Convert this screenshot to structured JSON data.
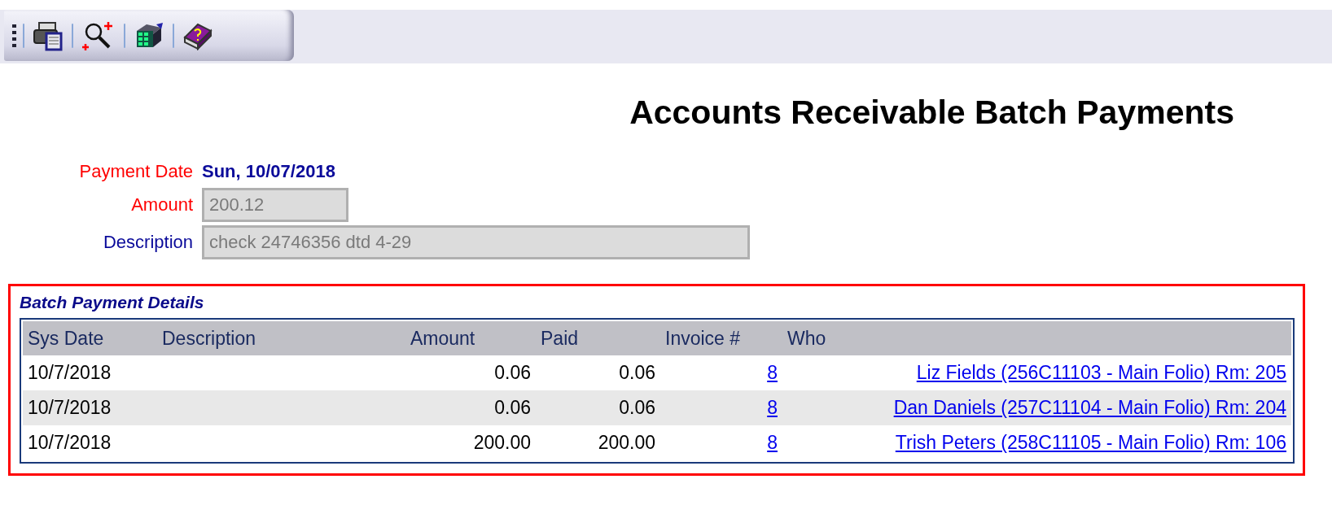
{
  "toolbar": {
    "buttons": [
      {
        "kind": "print"
      },
      {
        "kind": "zoom"
      },
      {
        "kind": "blocks"
      },
      {
        "kind": "help"
      }
    ]
  },
  "title": "Accounts Receivable Batch Payments",
  "form": [
    {
      "kind": "text",
      "label": "Payment Date",
      "required": true,
      "value": "Sun, 10/07/2018"
    },
    {
      "kind": "short",
      "label": "Amount",
      "required": true,
      "value": "200.12",
      "disabled": true
    },
    {
      "kind": "long",
      "label": "Description",
      "required": false,
      "value": "check 24746356 dtd 4-29",
      "disabled": true
    }
  ],
  "details": {
    "title": "Batch Payment Details",
    "columns": [
      "Sys Date",
      "Description",
      "Amount",
      "Paid",
      "Invoice #",
      "Who"
    ],
    "rows": [
      {
        "sys_date": "10/7/2018",
        "amount": "0.06",
        "paid": "0.06",
        "invoice": "8",
        "who": "Liz Fields (256C11103 - Main Folio) Rm: 205"
      },
      {
        "sys_date": "10/7/2018",
        "amount": "0.06",
        "paid": "0.06",
        "invoice": "8",
        "who": "Dan Daniels (257C11104 - Main Folio) Rm: 204"
      },
      {
        "sys_date": "10/7/2018",
        "amount": "200.00",
        "paid": "200.00",
        "invoice": "8",
        "who": "Trish Peters (258C11105 - Main Folio) Rm: 106"
      }
    ]
  }
}
